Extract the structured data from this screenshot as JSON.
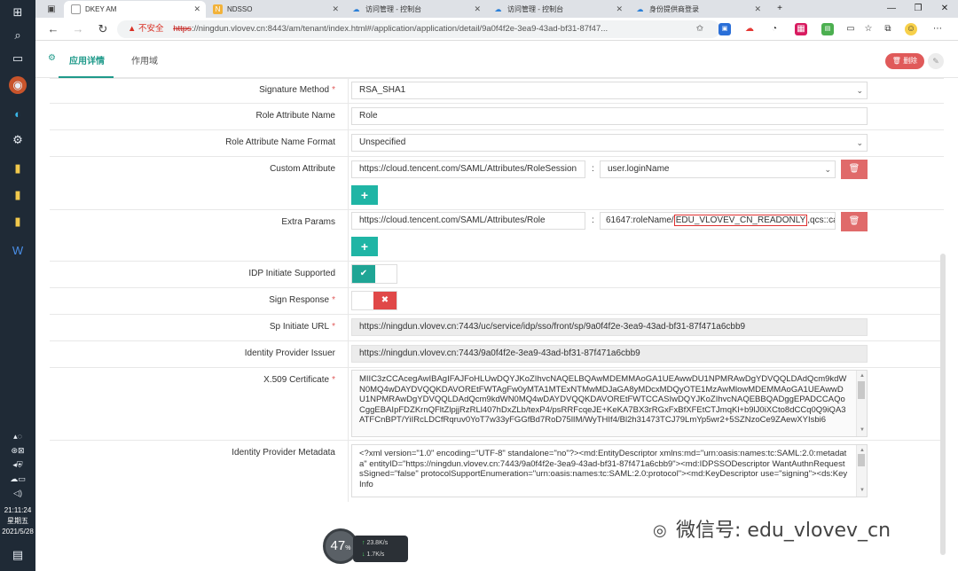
{
  "browser": {
    "tabs": [
      {
        "label": "DKEY AM"
      },
      {
        "label": "NDSSO"
      },
      {
        "label": "访问管理 - 控制台"
      },
      {
        "label": "访问管理 - 控制台"
      },
      {
        "label": "身份提供商登录"
      }
    ],
    "security_label": "不安全",
    "url_scheme": "https",
    "url_rest": "://ningdun.vlovev.cn:8443/am/tenant/index.html#/application/application/detail/9a0f4f2e-3ea9-43ad-bf31-87f47..."
  },
  "taskbar": {
    "time": "21:11:24",
    "weekday": "星期五",
    "date": "2021/5/28"
  },
  "header": {
    "tab_detail": "应用详情",
    "tab_scope": "作用域",
    "delete_label": "删除"
  },
  "form": {
    "signature_method": {
      "label": "Signature Method",
      "value": "RSA_SHA1"
    },
    "role_attr_name": {
      "label": "Role Attribute Name",
      "value": "Role"
    },
    "role_attr_format": {
      "label": "Role Attribute Name Format",
      "value": "Unspecified"
    },
    "custom_attr": {
      "label": "Custom Attribute",
      "key": "https://cloud.tencent.com/SAML/Attributes/RoleSession",
      "value": "user.loginName"
    },
    "extra_params": {
      "label": "Extra Params",
      "key": "https://cloud.tencent.com/SAML/Attributes/Role",
      "value_pre": "61647:roleName/",
      "value_hl": "EDU_VLOVEV_CN_READONLY",
      "value_post": ",qcs::cam"
    },
    "idp_initiate": {
      "label": "IDP Initiate Supported"
    },
    "sign_response": {
      "label": "Sign Response"
    },
    "sp_url": {
      "label": "Sp Initiate URL",
      "value": "https://ningdun.vlovev.cn:7443/uc/service/idp/sso/front/sp/9a0f4f2e-3ea9-43ad-bf31-87f471a6cbb9"
    },
    "idp_issuer": {
      "label": "Identity Provider Issuer",
      "value": "https://ningdun.vlovev.cn:7443/9a0f4f2e-3ea9-43ad-bf31-87f471a6cbb9"
    },
    "x509": {
      "label": "X.509 Certificate",
      "value": "MIIC3zCCAcegAwIBAgIFAJFoHLUwDQYJKoZIhvcNAQELBQAwMDEMMAoGA1UEAwwDU1NPMRAwDgYDVQQLDAdQcm9kdWN0MQ4wDAYDVQQKDAVOREtFWTAgFw0yMTA1MTExNTMwMDJaGA8yMDcxMDQyOTE1MzAwMlowMDEMMAoGA1UEAwwDU1NPMRAwDgYDVQQLDAdQcm9kdWN0MQ4wDAYDVQQKDAVOREtFWTCCASIwDQYJKoZIhvcNAQEBBQADggEPADCCAQoCggEBAIpFDZKrnQFltZlpjjRzRLl407hDxZLb/texP4/psRRFcqeJE+KeKA7BX3rRGxFxBfXFEtCTJmqKl+b9lJ0iXCto8dCCq0Q9iQA3ATFCnBPT/YiIRcLDCfRqruv0YoT7w33yFGGfBd7RoD75lIM/WyTHIf4/Bl2h31473TCJ79LmYp5wr2+5SZNzoCe9ZAewXYIsbi6"
    },
    "idp_metadata": {
      "label": "Identity Provider Metadata",
      "value": "<?xml version=\"1.0\" encoding=\"UTF-8\" standalone=\"no\"?><md:EntityDescriptor xmlns:md=\"urn:oasis:names:tc:SAML:2.0:metadata\" entityID=\"https://ningdun.vlovev.cn:7443/9a0f4f2e-3ea9-43ad-bf31-87f471a6cbb9\"><md:IDPSSODescriptor WantAuthnRequestsSigned=\"false\" protocolSupportEnumeration=\"urn:oasis:names:tc:SAML:2.0:protocol\"><md:KeyDescriptor use=\"signing\"><ds:KeyInfo"
    }
  },
  "overlay": {
    "cpu_percent": "47",
    "cpu_unit": "%",
    "up_speed": "23.8",
    "down_speed": "1.7",
    "speed_unit": "K/s",
    "watermark": "微信号: edu_vlovev_cn"
  },
  "colors": {
    "accent": "#1f9a8a",
    "danger": "#e05a5a"
  }
}
